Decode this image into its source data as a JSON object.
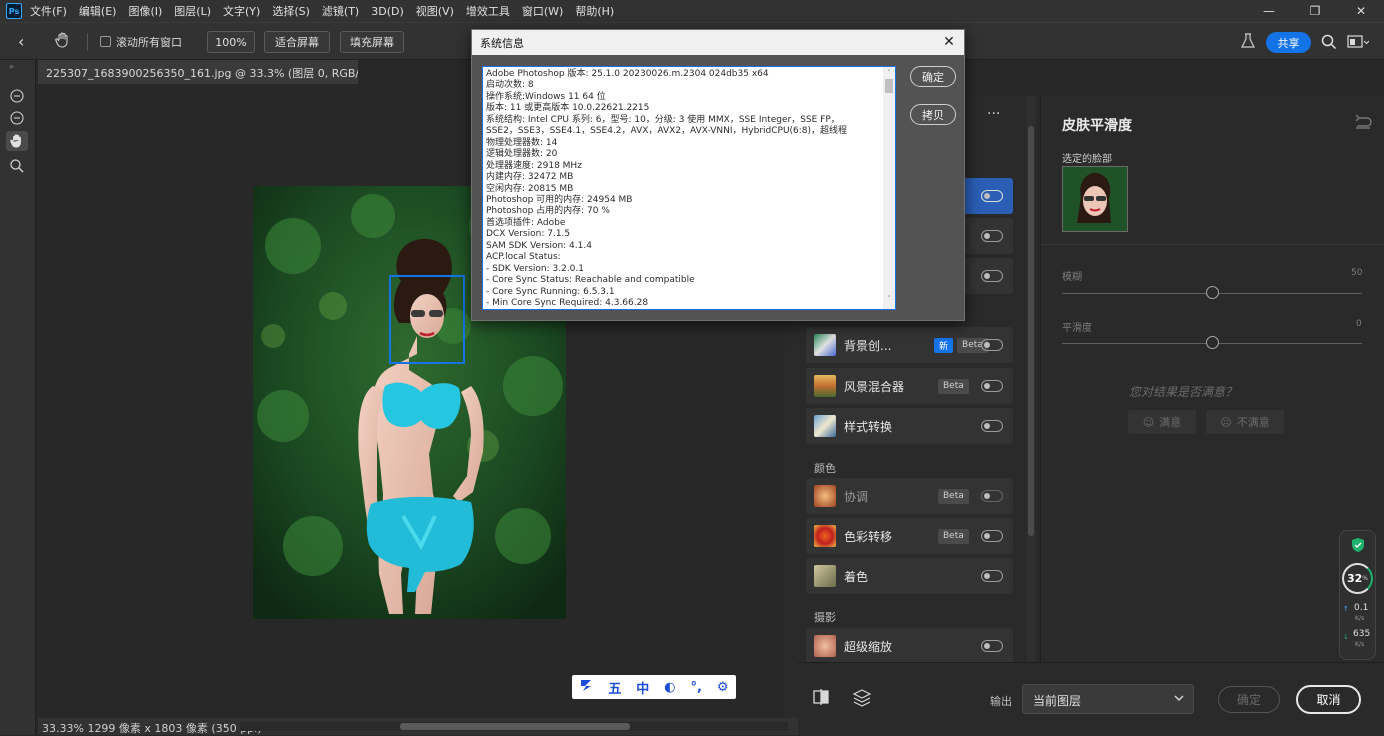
{
  "menubar": {
    "logo": "Ps",
    "items": [
      "文件(F)",
      "编辑(E)",
      "图像(I)",
      "图层(L)",
      "文字(Y)",
      "选择(S)",
      "滤镜(T)",
      "3D(D)",
      "视图(V)",
      "增效工具",
      "窗口(W)",
      "帮助(H)"
    ],
    "window_controls": [
      "—",
      "❐",
      "✕"
    ]
  },
  "optionsbar": {
    "scroll_all_windows": "滚动所有窗口",
    "zoom": "100%",
    "fit_screen": "适合屏幕",
    "fill_screen": "填充屏幕",
    "share": "共享"
  },
  "document": {
    "tab_title": "225307_1683900256350_161.jpg @ 33.3% (图层 0, RGB/8#) *",
    "status": "33.33%   1299 像素 x 1803 像素 (350 ppi)"
  },
  "dialog": {
    "title": "系统信息",
    "ok": "确定",
    "copy": "拷贝",
    "lines": [
      "Adobe Photoshop 版本: 25.1.0 20230026.m.2304 024db35  x64",
      "启动次数: 8",
      "操作系统:Windows 11 64 位",
      "版本: 11 或更高版本 10.0.22621.2215",
      "系统结构: Intel CPU 系列: 6，型号: 10，分级: 3 使用 MMX，SSE Integer，SSE FP，",
      "SSE2，SSE3，SSE4.1，SSE4.2，AVX，AVX2，AVX-VNNI，HybridCPU(6:8)，超线程",
      "物理处理器数: 14",
      "逻辑处理器数: 20",
      "处理器速度: 2918 MHz",
      "内建内存: 32472 MB",
      "空闲内存: 20815 MB",
      "Photoshop 可用的内存: 24954 MB",
      "Photoshop 占用的内存: 70 %",
      "首选项插件: Adobe",
      "DCX Version: 7.1.5",
      "SAM SDK Version: 4.1.4",
      "ACP.local Status:",
      "  - SDK Version: 3.2.0.1",
      "  - Core Sync Status: Reachable and compatible",
      "  - Core Sync Running: 6.5.3.1",
      "  - Min Core Sync Required: 4.3.66.28"
    ]
  },
  "filters": {
    "more": "···",
    "sections": {
      "color": "颜色",
      "photo": "摄影"
    },
    "items": [
      {
        "name": "背景创...",
        "badges": [
          "新",
          "Beta"
        ]
      },
      {
        "name": "风景混合器",
        "badges": [
          "Beta"
        ]
      },
      {
        "name": "样式转换",
        "badges": []
      },
      {
        "name": "协调",
        "badges": [
          "Beta"
        ]
      },
      {
        "name": "色彩转移",
        "badges": [
          "Beta"
        ]
      },
      {
        "name": "着色",
        "badges": []
      },
      {
        "name": "超级缩放",
        "badges": []
      }
    ]
  },
  "skin_panel": {
    "title": "皮肤平滑度",
    "selected_face_label": "选定的脸部",
    "blur_label": "模糊",
    "blur_value": "50",
    "smooth_label": "平滑度",
    "smooth_value": "0",
    "blur_level": 0.5,
    "smooth_level": 0.5,
    "feedback_question": "您对结果是否满意？",
    "satisfied": "满意",
    "unsatisfied": "不满意"
  },
  "bottombar": {
    "output_label": "输出",
    "output_value": "当前图层",
    "ok": "确定",
    "cancel": "取消"
  },
  "ime": [
    "五",
    "中",
    "◐",
    "°,",
    "⚙"
  ],
  "netmon": {
    "percent": "32",
    "percent_unit": "%",
    "upload_value": "0.1",
    "upload_unit": "K/s",
    "download_value": "635",
    "download_unit": "K/s"
  },
  "colors": {
    "accent": "#1473e6",
    "selected_filter": "#2b5eb5",
    "panel_bg": "#2a2a2a"
  }
}
